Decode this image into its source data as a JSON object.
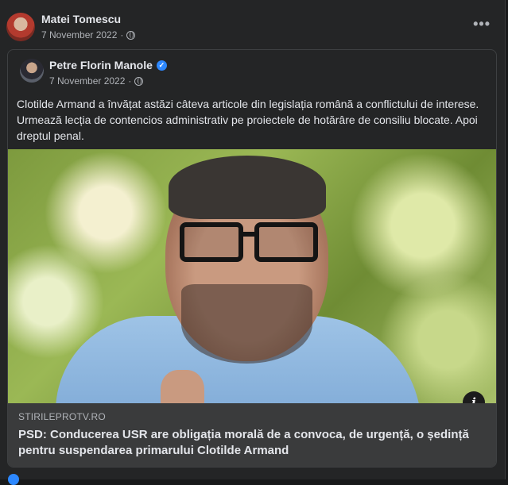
{
  "post": {
    "author": "Matei Tomescu",
    "date": "7 November 2022",
    "separator": "·",
    "more_label": "•••"
  },
  "shared": {
    "author": "Petre Florin Manole",
    "verified_mark": "✓",
    "date": "7 November 2022",
    "separator": "·",
    "text": "Clotilde Armand a învățat astăzi câteva articole din legislația română a conflictului de interese. Urmează lecția de contencios administrativ pe proiectele de hotărâre de consiliu blocate. Apoi dreptul penal.",
    "info_label": "i",
    "link": {
      "domain": "STIRILEPROTV.RO",
      "headline": "PSD: Conducerea USR are obligația morală de a convoca, de urgență, o ședință pentru suspendarea primarului Clotilde Armand"
    }
  },
  "colors": {
    "background": "#242526",
    "text": "#e4e6eb",
    "muted": "#b0b3b8",
    "verified": "#2d88ff",
    "link_bar": "#3a3b3c"
  },
  "icons": [
    "globe-icon",
    "more-options-icon",
    "verified-badge-icon",
    "info-icon"
  ]
}
